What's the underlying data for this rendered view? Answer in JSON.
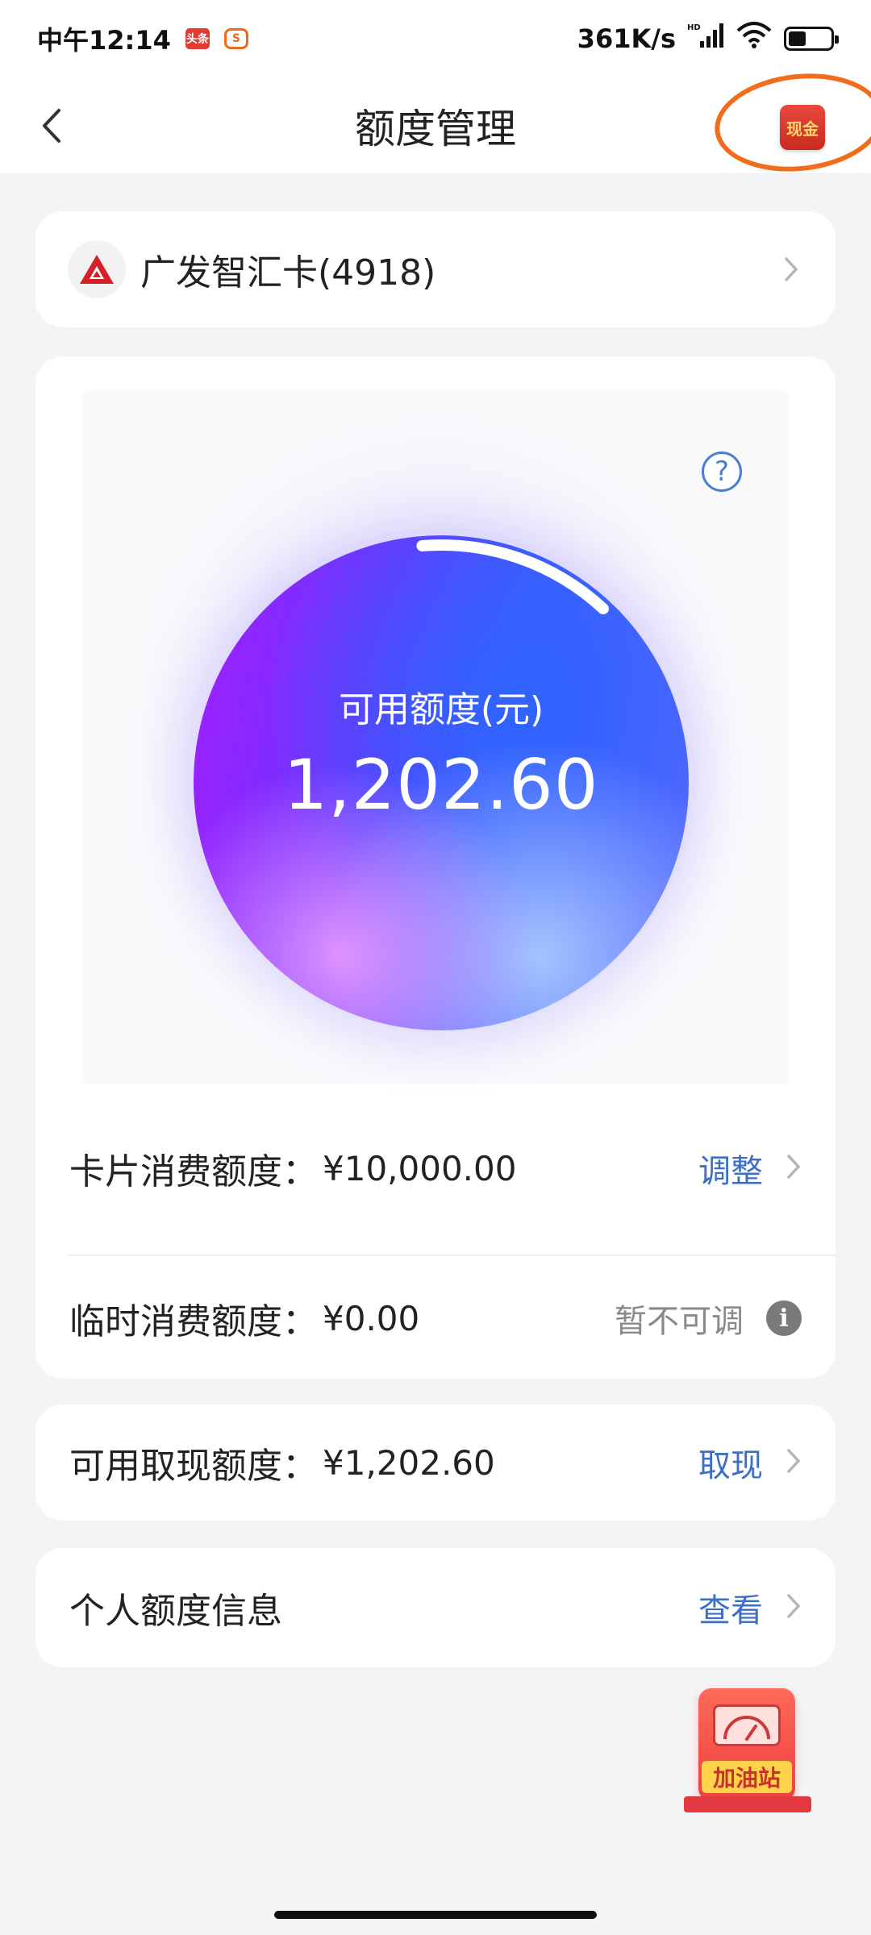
{
  "status_bar": {
    "time": "中午12:14",
    "badge_toutiao": "头条",
    "badge_s": "S",
    "network_speed": "361K/s",
    "hd_label": "HD"
  },
  "nav": {
    "title": "额度管理",
    "cash_icon_label": "现金"
  },
  "card_selector": {
    "name": "广发智汇卡(4918)"
  },
  "credit": {
    "available_label": "可用额度(元)",
    "available_value": "1,202.60",
    "help_symbol": "?",
    "arc_progress": 0.12
  },
  "rows": {
    "card_limit": {
      "label": "卡片消费额度：",
      "value": "¥10,000.00",
      "action": "调整"
    },
    "temp_limit": {
      "label": "临时消费额度：",
      "value": "¥0.00",
      "status": "暂不可调",
      "info_symbol": "i"
    },
    "cash_limit": {
      "label": "可用取现额度：",
      "value": "¥1,202.60",
      "action": "取现"
    },
    "personal_info": {
      "label": "个人额度信息",
      "action": "查看"
    }
  },
  "fuel_station": {
    "label": "加油站"
  },
  "colors": {
    "link": "#3d6fc4",
    "accent_red": "#e2383f",
    "orb_purple": "#a21cff",
    "orb_blue": "#3e5cff"
  }
}
